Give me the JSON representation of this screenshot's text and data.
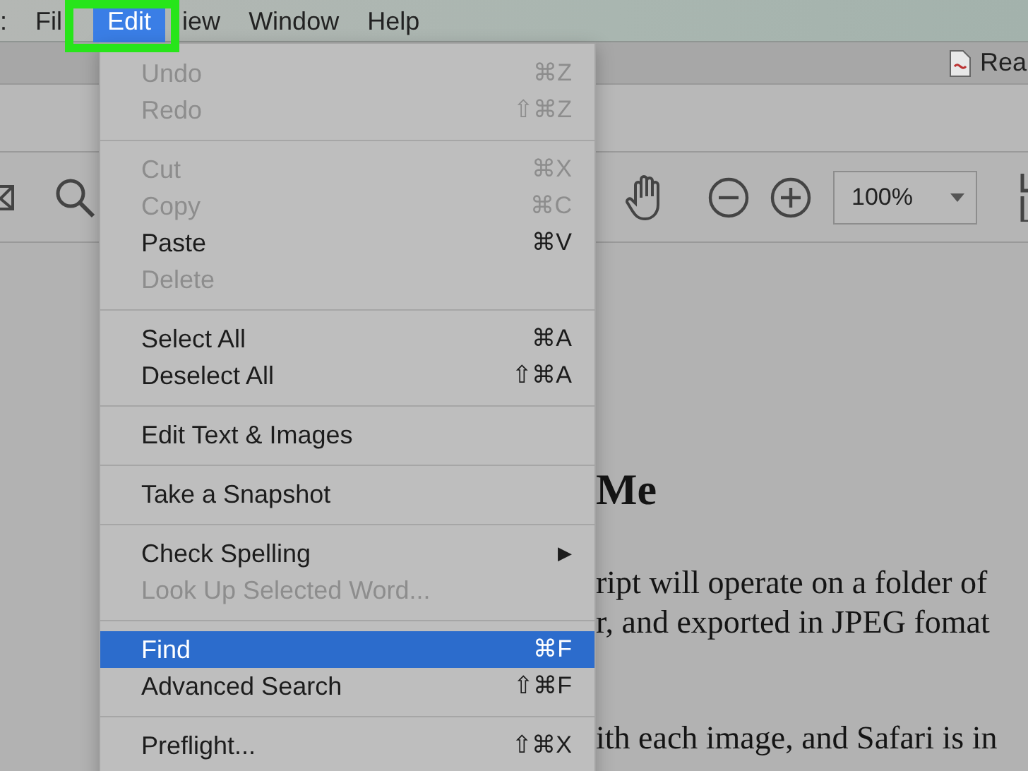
{
  "menu_bar": {
    "items": [
      {
        "label": ":",
        "selected": false
      },
      {
        "label": "Fil",
        "selected": false
      },
      {
        "label": "Edit",
        "selected": true
      },
      {
        "label": "iew",
        "selected": false
      },
      {
        "label": "Window",
        "selected": false
      },
      {
        "label": "Help",
        "selected": false
      }
    ]
  },
  "tab_bar": {
    "document_tab": "Rea"
  },
  "toolbar": {
    "zoom": "100%"
  },
  "document": {
    "heading": "Me",
    "lines": [
      "ript will operate on a folder of",
      "r, and exported in JPEG fomat",
      "ith each image, and Safari is in"
    ]
  },
  "edit_menu": {
    "groups": [
      [
        {
          "label": "Undo",
          "shortcut": "⌘Z",
          "disabled": true,
          "selected": false
        },
        {
          "label": "Redo",
          "shortcut": "⇧⌘Z",
          "disabled": true,
          "selected": false
        }
      ],
      [
        {
          "label": "Cut",
          "shortcut": "⌘X",
          "disabled": true,
          "selected": false
        },
        {
          "label": "Copy",
          "shortcut": "⌘C",
          "disabled": true,
          "selected": false
        },
        {
          "label": "Paste",
          "shortcut": "⌘V",
          "disabled": false,
          "selected": false
        },
        {
          "label": "Delete",
          "disabled": true,
          "selected": false
        }
      ],
      [
        {
          "label": "Select All",
          "shortcut": "⌘A",
          "disabled": false,
          "selected": false
        },
        {
          "label": "Deselect All",
          "shortcut": "⇧⌘A",
          "disabled": false,
          "selected": false
        }
      ],
      [
        {
          "label": "Edit Text & Images",
          "disabled": false,
          "selected": false
        }
      ],
      [
        {
          "label": "Take a Snapshot",
          "disabled": false,
          "selected": false
        }
      ],
      [
        {
          "label": "Check Spelling",
          "submenu_arrow": "▶",
          "disabled": false,
          "selected": false
        },
        {
          "label": "Look Up Selected Word...",
          "disabled": true,
          "selected": false
        }
      ],
      [
        {
          "label": "Find",
          "shortcut": "⌘F",
          "disabled": false,
          "selected": true
        },
        {
          "label": "Advanced Search",
          "shortcut": "⇧⌘F",
          "disabled": false,
          "selected": false
        }
      ],
      [
        {
          "label": "Preflight...",
          "shortcut": "⇧⌘X",
          "disabled": false,
          "selected": false
        }
      ]
    ]
  }
}
